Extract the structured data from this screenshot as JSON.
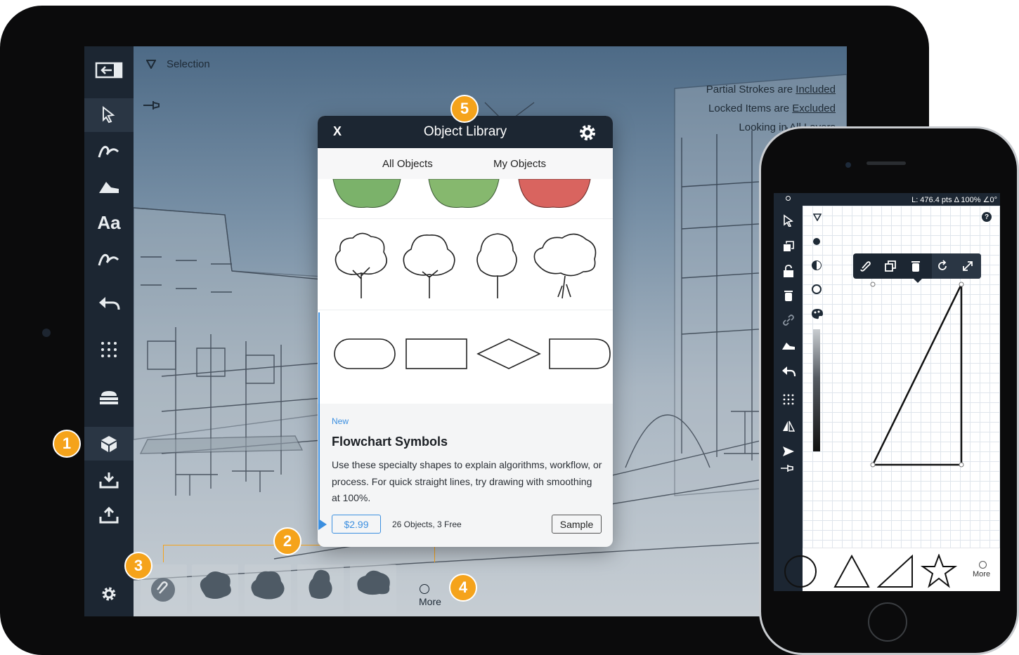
{
  "ipad": {
    "topbar": {
      "mode_label": "Selection",
      "help_label": "?"
    },
    "info": {
      "line1_prefix": "Partial Strokes are ",
      "line1_link": "Included",
      "line2_prefix": "Locked Items are ",
      "line2_link": "Excluded",
      "line3": "Looking in All Layers"
    },
    "sidebar": {
      "text_tool_label": "Aa"
    },
    "tray": {
      "more_label": "More"
    }
  },
  "modal": {
    "close_label": "X",
    "title": "Object Library",
    "tabs": [
      "All Objects",
      "My Objects"
    ],
    "card": {
      "tag": "New",
      "title": "Flowchart Symbols",
      "description": "Use these specialty shapes to explain algorithms, workflow, or process. For quick straight lines, try drawing with smoothing at 100%.",
      "price": "$2.99",
      "count": "26 Objects, 3 Free",
      "sample_label": "Sample"
    }
  },
  "callouts": [
    "1",
    "2",
    "3",
    "4",
    "5"
  ],
  "iphone": {
    "status_text": "L: 476.4 pts Δ 100% ∠0°",
    "help_label": "?",
    "more_label": "More"
  },
  "colors": {
    "ui_dark": "#1c2632",
    "callout": "#f5a31b",
    "accent_blue": "#3b8fe0"
  }
}
